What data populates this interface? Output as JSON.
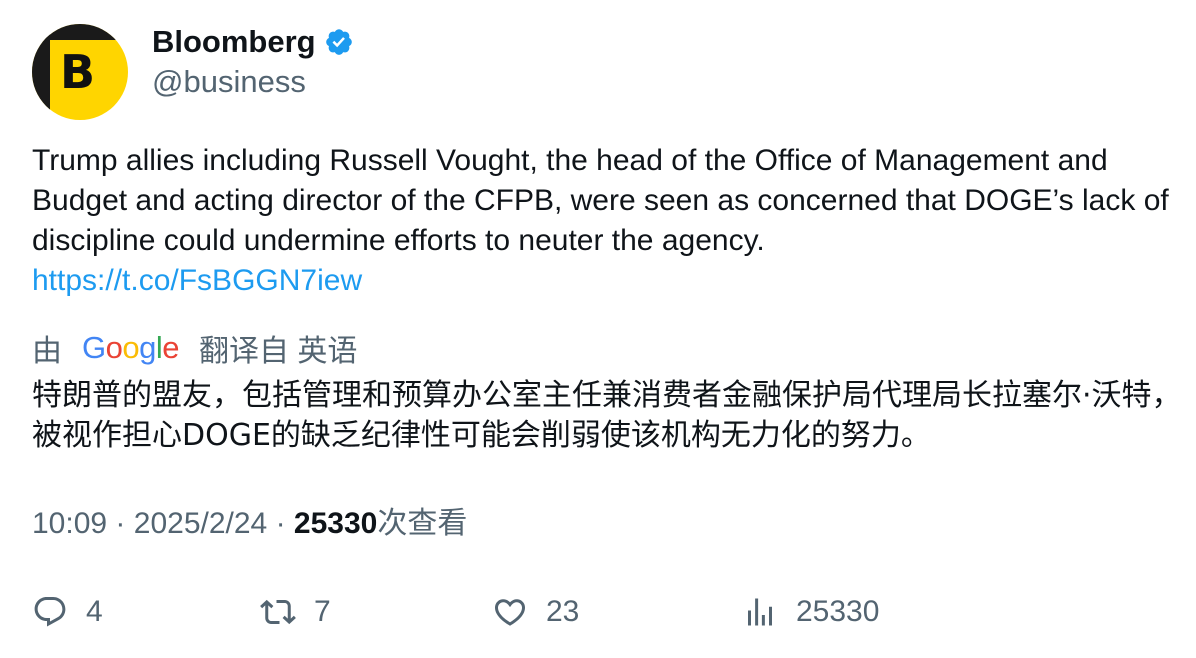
{
  "author": {
    "display_name": "Bloomberg",
    "handle": "@business",
    "avatar_letter": "B",
    "verified": true
  },
  "tweet": {
    "text": "Trump allies including Russell Vought, the head of the Office of Management and Budget and acting director of the CFPB, were seen as concerned that DOGE’s lack of discipline could undermine efforts to neuter the agency.",
    "link": "https://t.co/FsBGGN7iew"
  },
  "translation": {
    "prefix": "由",
    "provider": "Google",
    "suffix": "翻译自 英语",
    "text": "特朗普的盟友，包括管理和预算办公室主任兼消费者金融保护局代理局长拉塞尔·沃特，被视作担心DOGE的缺乏纪律性可能会削弱使该机构无力化的努力。"
  },
  "meta": {
    "time": "10:09",
    "separator": "·",
    "date": "2025/2/24",
    "views_count": "25330",
    "views_label": "次查看"
  },
  "actions": {
    "replies": "4",
    "retweets": "7",
    "likes": "23",
    "views": "25330"
  },
  "colors": {
    "link": "#1d9bf0",
    "verified": "#1d9bf0",
    "secondary_text": "#536471",
    "avatar_bg": "#ffd500"
  },
  "icons": [
    "verified-badge-icon",
    "reply-icon",
    "retweet-icon",
    "like-icon",
    "views-icon",
    "google-logo"
  ]
}
